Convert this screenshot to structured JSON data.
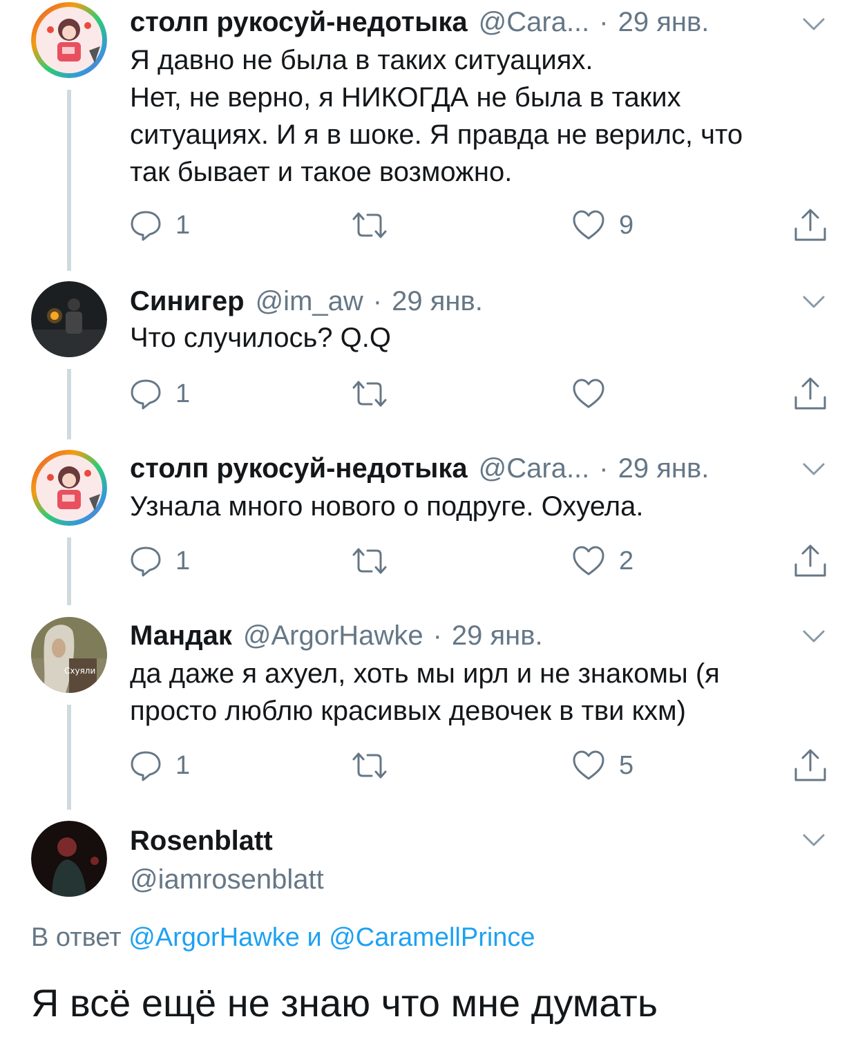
{
  "tweets": [
    {
      "name": "столп рукосуй-недотыка",
      "handle": "@Cara...",
      "date": "29 янв.",
      "lines": [
        "Я давно не была в таких ситуациях.",
        "Нет, не верно, я НИКОГДА не была в таких",
        "ситуациях. И я в шоке. Я правда не верилс, что",
        "так бывает и такое возможно."
      ],
      "replies": "1",
      "retweets": "",
      "likes": "9",
      "avatar": "anime-girl-avatar"
    },
    {
      "name": "Синигер",
      "handle": "@im_aw",
      "date": "29 янв.",
      "lines": [
        "Что случилось? Q.Q"
      ],
      "replies": "1",
      "retweets": "",
      "likes": "",
      "avatar": "dark-photo-avatar"
    },
    {
      "name": "столп рукосуй-недотыка",
      "handle": "@Cara...",
      "date": "29 янв.",
      "lines": [
        "Узнала много нового о подруге. Охуела."
      ],
      "replies": "1",
      "retweets": "",
      "likes": "2",
      "avatar": "anime-girl-avatar"
    },
    {
      "name": "Мандак",
      "handle": "@ArgorHawke",
      "date": "29 янв.",
      "lines": [
        "да даже я ахуел, хоть мы ирл и не знакомы (я",
        "просто люблю красивых девочек в тви кхм)"
      ],
      "replies": "1",
      "retweets": "",
      "likes": "5",
      "avatar": "long-hair-man-avatar",
      "avatar_caption": "Схуяли"
    }
  ],
  "main_tweet": {
    "name": "Rosenblatt",
    "handle": "@iamrosenblatt",
    "reply_prefix": "В ответ",
    "reply_to_1": "@ArgorHawke",
    "reply_and": "и",
    "reply_to_2": "@CaramellPrince",
    "text": "Я всё ещё не знаю что мне думать",
    "avatar": "red-light-portrait-avatar"
  },
  "dot_separator": "·",
  "colors": {
    "text": "#14171a",
    "secondary": "#657786",
    "link": "#1da1f2",
    "thread_line": "#cfd9de"
  },
  "icons": [
    "reply-icon",
    "retweet-icon",
    "like-icon",
    "share-icon",
    "chevron-down-icon"
  ]
}
